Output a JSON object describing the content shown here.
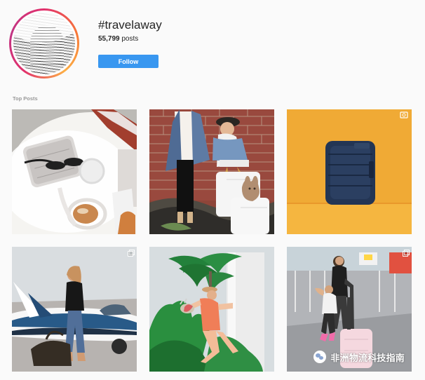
{
  "profile": {
    "title": "#travelaway",
    "posts_count": "55,799",
    "posts_label": "posts",
    "follow_label": "Follow"
  },
  "section": {
    "label": "Top Posts"
  },
  "watermark": {
    "text": "非洲物流科技指南"
  },
  "colors": {
    "accent": "#3897f0",
    "background": "#fafafa",
    "text": "#262626",
    "muted": "#999999"
  }
}
